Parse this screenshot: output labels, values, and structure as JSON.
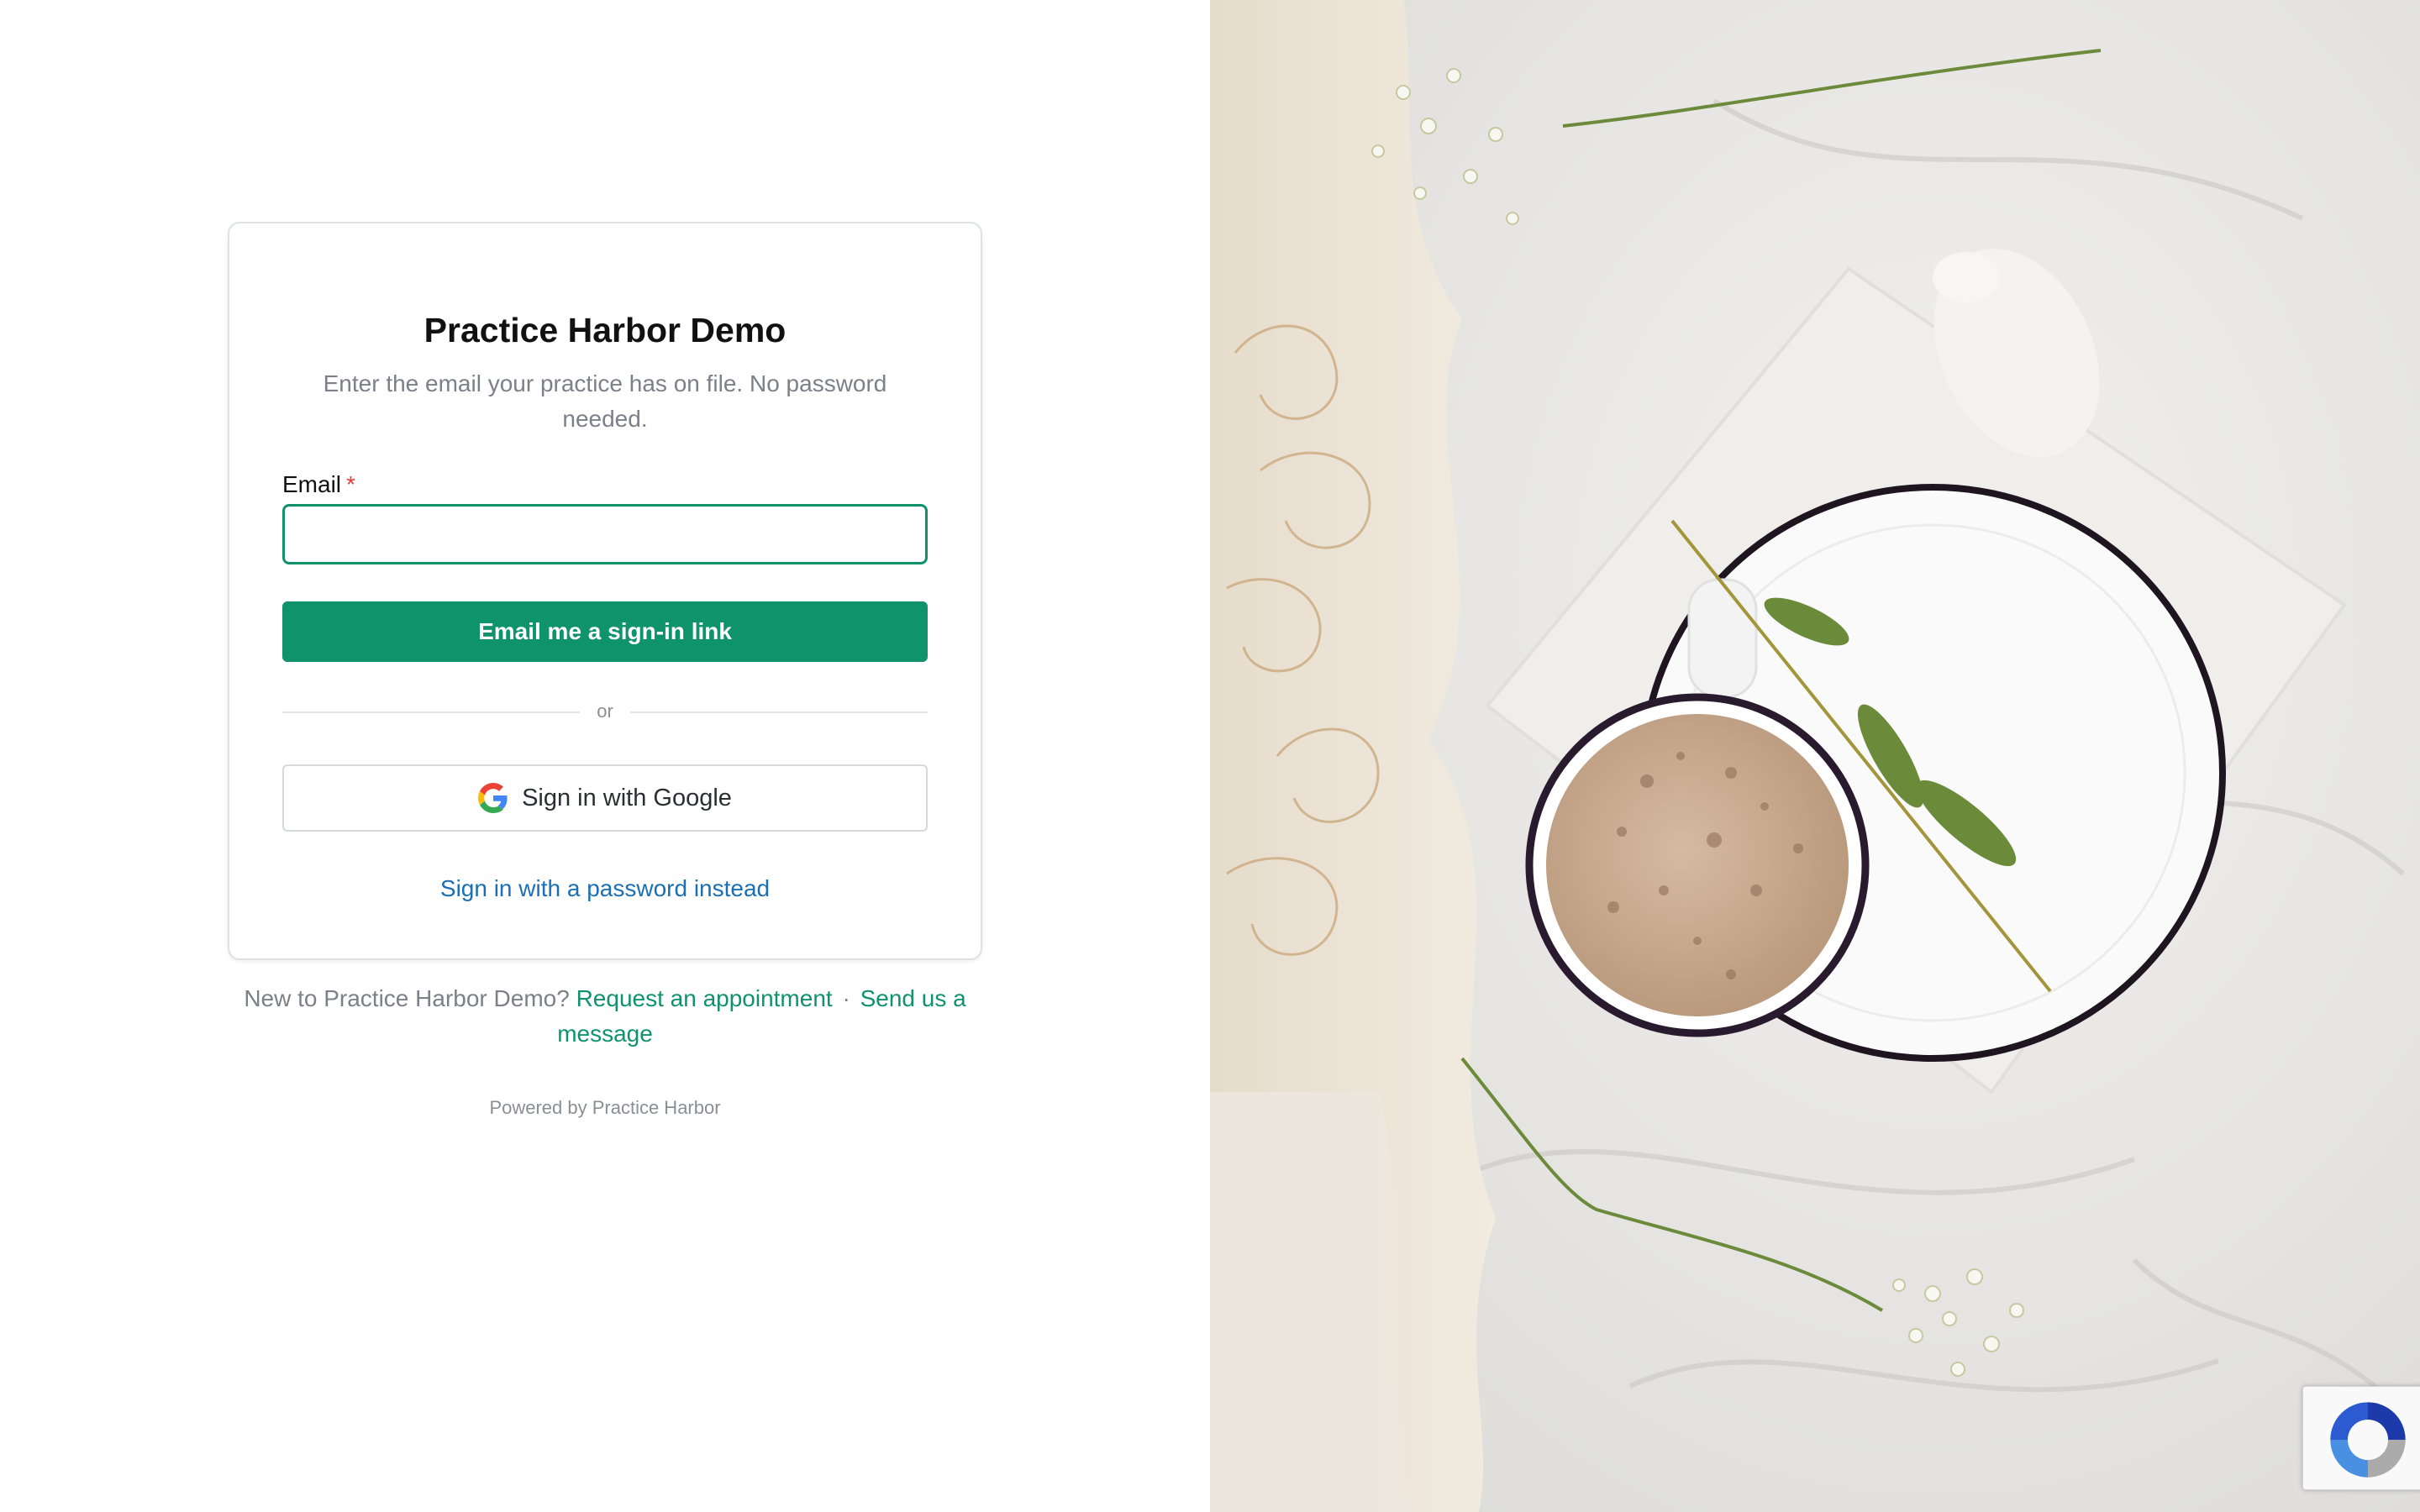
{
  "login": {
    "title": "Practice Harbor Demo",
    "subtitle": "Enter the email your practice has on file. No password needed.",
    "email_label": "Email",
    "required_mark": "*",
    "email_value": "",
    "email_placeholder": "",
    "submit_label": "Email me a sign-in link",
    "divider_text": "or",
    "google_label": "Sign in with Google",
    "password_link": "Sign in with a password instead"
  },
  "footer": {
    "prompt": "New to Practice Harbor Demo?",
    "request_link": "Request an appointment",
    "separator": "·",
    "message_link": "Send us a message",
    "powered_by": "Powered by Practice Harbor"
  },
  "colors": {
    "brand_green": "#0e936a",
    "link_blue": "#1a6fb5",
    "required_red": "#e23a3a"
  },
  "hero_image": {
    "icon": "coffee-cup-on-plate-photo"
  },
  "recaptcha": {
    "icon": "recaptcha-icon"
  }
}
